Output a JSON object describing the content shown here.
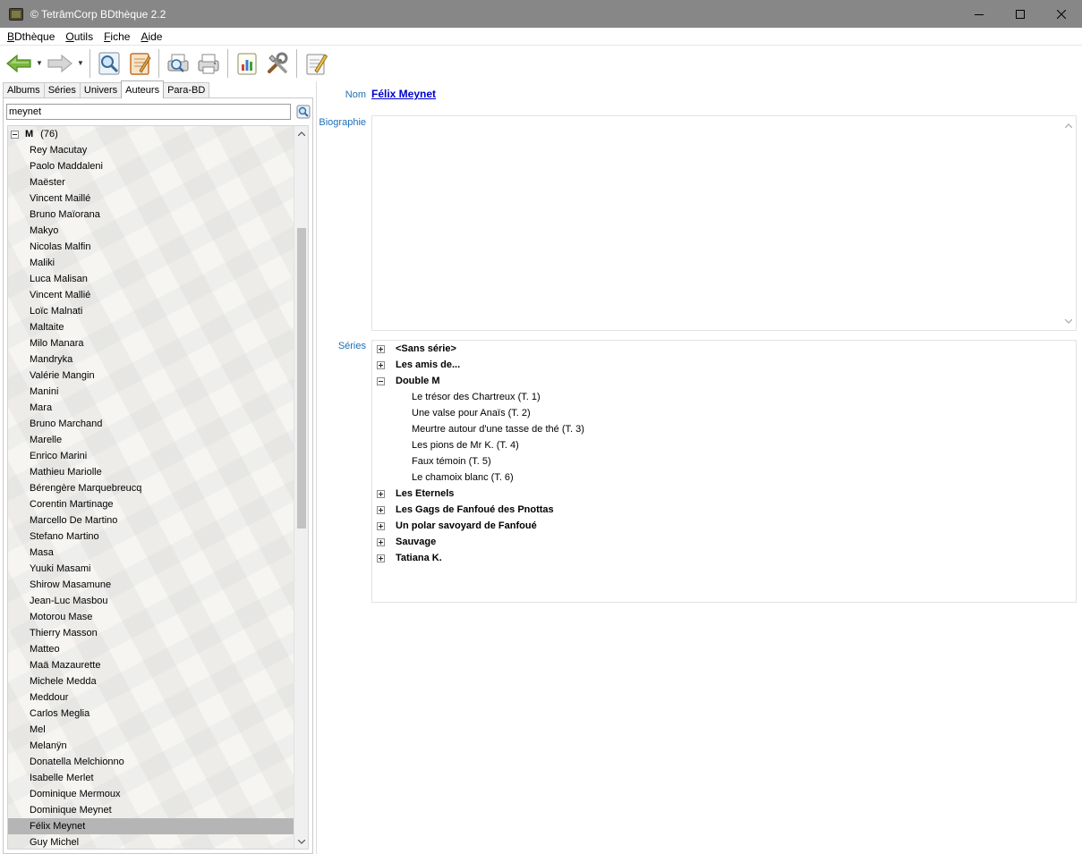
{
  "window": {
    "title": "© TetrâmCorp BDthèque 2.2"
  },
  "menu": [
    {
      "label": "BDthèque"
    },
    {
      "label": "Outils"
    },
    {
      "label": "Fiche"
    },
    {
      "label": "Aide"
    }
  ],
  "tabs": [
    {
      "label": "Albums"
    },
    {
      "label": "Séries"
    },
    {
      "label": "Univers"
    },
    {
      "label": "Auteurs"
    },
    {
      "label": "Para-BD"
    }
  ],
  "search": {
    "value": "meynet"
  },
  "tree": {
    "group": {
      "letter": "M",
      "count": "(76)"
    },
    "items": [
      "Rey Macutay",
      "Paolo Maddaleni",
      "Maëster",
      "Vincent Maillé",
      "Bruno Maïorana",
      "Makyo",
      "Nicolas Malfin",
      "Maliki",
      "Luca Malisan",
      "Vincent Mallié",
      "Loïc Malnati",
      "Maltaite",
      "Milo Manara",
      "Mandryka",
      "Valérie Mangin",
      "Manini",
      "Mara",
      "Bruno Marchand",
      "Marelle",
      "Enrico Marini",
      "Mathieu Mariolle",
      "Bérengère Marquebreucq",
      "Corentin Martinage",
      "Marcello De Martino",
      "Stefano Martino",
      "Masa",
      "Yuuki Masami",
      "Shirow Masamune",
      "Jean-Luc Masbou",
      "Motorou Mase",
      "Thierry Masson",
      "Matteo",
      "Maä Mazaurette",
      "Michele Medda",
      "Meddour",
      "Carlos Meglia",
      "Mel",
      "Melanÿn",
      "Donatella Melchionno",
      "Isabelle Merlet",
      "Dominique Mermoux",
      "Dominique Meynet",
      "Félix Meynet",
      "Guy Michel"
    ],
    "selected_index": 42
  },
  "detail": {
    "name_label": "Nom",
    "name_value": "Félix Meynet",
    "bio_label": "Biographie",
    "series_label": "Séries",
    "series": [
      {
        "title": "<Sans série>",
        "expanded": false,
        "albums": []
      },
      {
        "title": "Les amis de...",
        "expanded": false,
        "albums": []
      },
      {
        "title": "Double M",
        "expanded": true,
        "albums": [
          "Le trésor des Chartreux (T. 1)",
          "Une valse pour Anaïs (T. 2)",
          "Meurtre autour d'une tasse de thé (T. 3)",
          "Les pions de Mr K. (T. 4)",
          "Faux témoin (T. 5)",
          "Le chamoix blanc (T. 6)"
        ]
      },
      {
        "title": "Les Eternels",
        "expanded": false,
        "albums": []
      },
      {
        "title": "Les Gags de Fanfoué des Pnottas",
        "expanded": false,
        "albums": []
      },
      {
        "title": "Un polar savoyard de Fanfoué",
        "expanded": false,
        "albums": []
      },
      {
        "title": "Sauvage",
        "expanded": false,
        "albums": []
      },
      {
        "title": "Tatiana K.",
        "expanded": false,
        "albums": []
      }
    ]
  },
  "colors": {
    "titlebar": "#878787",
    "label_blue": "#1d6fb8",
    "link": "#0000cc",
    "selection": "#b5b5b5"
  },
  "icons": {
    "toolbar": [
      "back-arrow-icon",
      "forward-arrow-icon",
      "search-magnifier-icon",
      "edit-notepad-icon",
      "preview-print-icon",
      "print-icon",
      "stats-chart-icon",
      "tools-icon",
      "notes-icon"
    ]
  }
}
